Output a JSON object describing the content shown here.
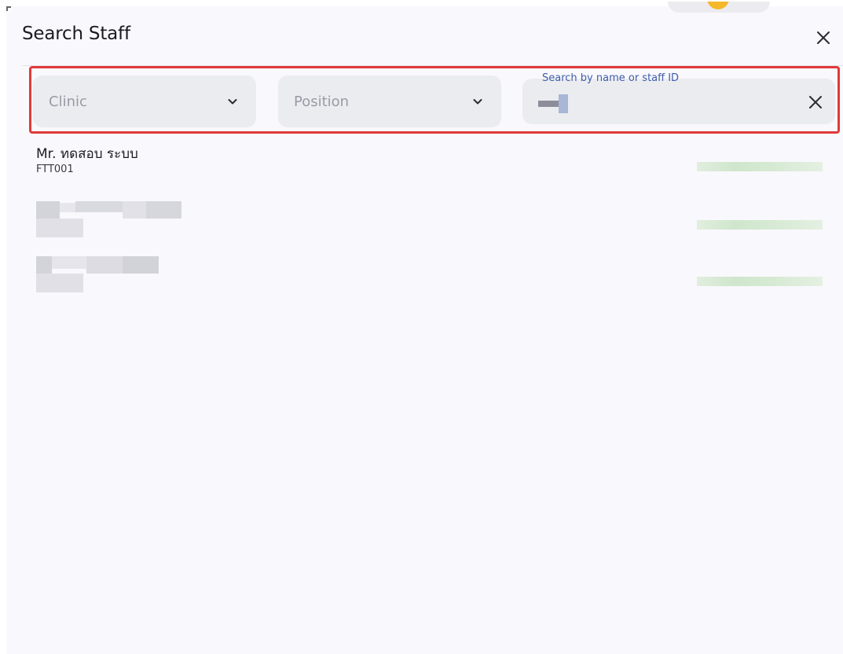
{
  "dialog": {
    "title": "Search Staff",
    "close_icon": "close-icon"
  },
  "filters": {
    "clinic": {
      "placeholder": "Clinic",
      "icon": "chevron-down-icon"
    },
    "position": {
      "placeholder": "Position",
      "icon": "chevron-down-icon"
    },
    "search": {
      "label": "Search by name or staff ID",
      "clear_icon": "close-icon"
    }
  },
  "results": [
    {
      "name": "Mr. ทดสอบ ระบบ",
      "staff_id": "FTT001"
    },
    {},
    {}
  ],
  "colors": {
    "highlight_border": "#e03a3a",
    "field_background": "#ebecf0",
    "dialog_background": "#f9f8fd",
    "floating_label": "#3d5ea8",
    "status_green": "#cfe6cc"
  }
}
